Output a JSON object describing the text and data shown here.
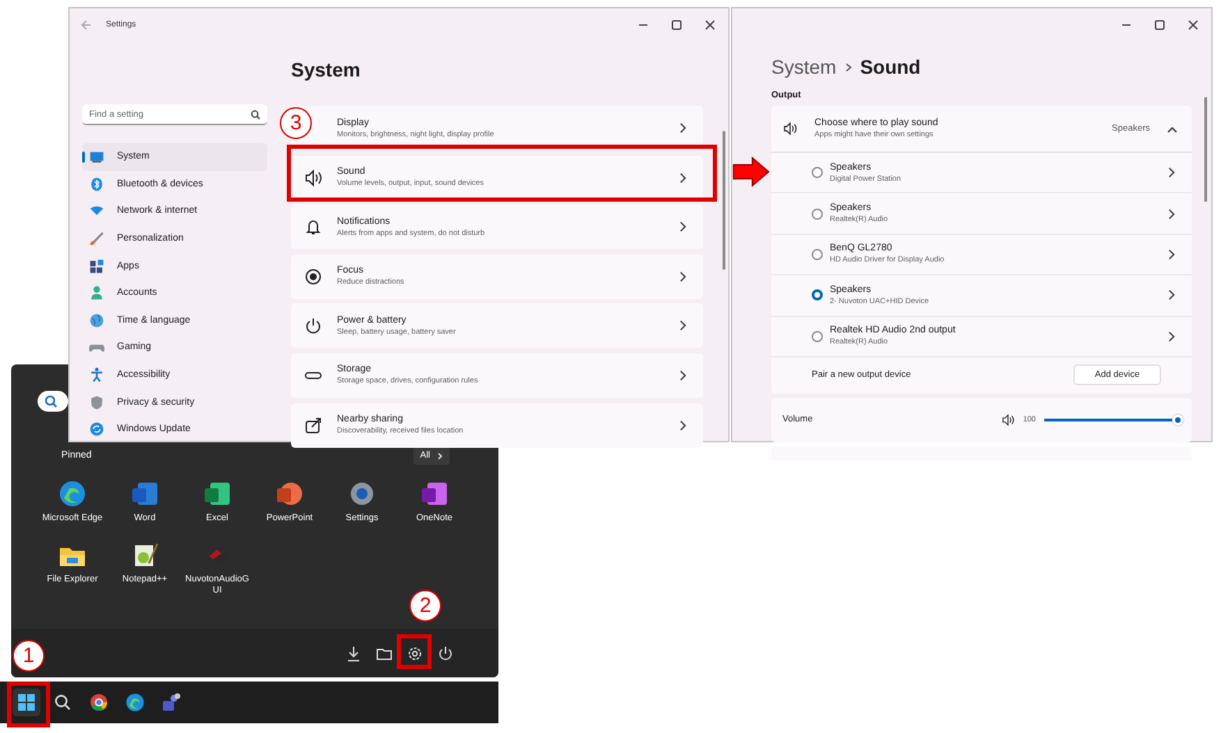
{
  "settings_window": {
    "title": "Settings",
    "search": {
      "placeholder": "Find a setting"
    },
    "nav": [
      {
        "label": "System",
        "selected": true
      },
      {
        "label": "Bluetooth & devices",
        "selected": false
      },
      {
        "label": "Network & internet",
        "selected": false
      },
      {
        "label": "Personalization",
        "selected": false
      },
      {
        "label": "Apps",
        "selected": false
      },
      {
        "label": "Accounts",
        "selected": false
      },
      {
        "label": "Time & language",
        "selected": false
      },
      {
        "label": "Gaming",
        "selected": false
      },
      {
        "label": "Accessibility",
        "selected": false
      },
      {
        "label": "Privacy & security",
        "selected": false
      },
      {
        "label": "Windows Update",
        "selected": false
      }
    ],
    "page_title": "System",
    "cards": [
      {
        "title": "Display",
        "subtitle": "Monitors, brightness, night light, display profile"
      },
      {
        "title": "Sound",
        "subtitle": "Volume levels, output, input, sound devices"
      },
      {
        "title": "Notifications",
        "subtitle": "Alerts from apps and system, do not disturb"
      },
      {
        "title": "Focus",
        "subtitle": "Reduce distractions"
      },
      {
        "title": "Power & battery",
        "subtitle": "Sleep, battery usage, battery saver"
      },
      {
        "title": "Storage",
        "subtitle": "Storage space, drives, configuration rules"
      },
      {
        "title": "Nearby sharing",
        "subtitle": "Discoverability, received files location"
      }
    ]
  },
  "sound_window": {
    "breadcrumb": [
      "System",
      "Sound"
    ],
    "section": "Output",
    "output": {
      "title": "Choose where to play sound",
      "subtitle": "Apps might have their own settings",
      "value": "Speakers",
      "expanded": true
    },
    "devices": [
      {
        "name": "Speakers",
        "detail": "Digital Power Station",
        "selected": false
      },
      {
        "name": "Speakers",
        "detail": "Realtek(R) Audio",
        "selected": false
      },
      {
        "name": "BenQ GL2780",
        "detail": "HD Audio Driver for Display Audio",
        "selected": false
      },
      {
        "name": "Speakers",
        "detail": "2- Nuvoton UAC+HID Device",
        "selected": true
      },
      {
        "name": "Realtek HD Audio 2nd output",
        "detail": "Realtek(R) Audio",
        "selected": false
      }
    ],
    "pair": {
      "label": "Pair a new output device",
      "button": "Add device"
    },
    "volume": {
      "label": "Volume",
      "value": "100",
      "level": 1
    }
  },
  "start_menu": {
    "pinned_label": "Pinned",
    "all_button": "All",
    "apps": [
      {
        "name": "Microsoft Edge"
      },
      {
        "name": "Word"
      },
      {
        "name": "Excel"
      },
      {
        "name": "PowerPoint"
      },
      {
        "name": "Settings"
      },
      {
        "name": "OneNote"
      },
      {
        "name": "File Explorer"
      },
      {
        "name": "Notepad++"
      },
      {
        "name": "NuvotonAudioGUI"
      }
    ]
  },
  "callouts": [
    {
      "number": "1"
    },
    {
      "number": "2"
    },
    {
      "number": "3"
    }
  ]
}
